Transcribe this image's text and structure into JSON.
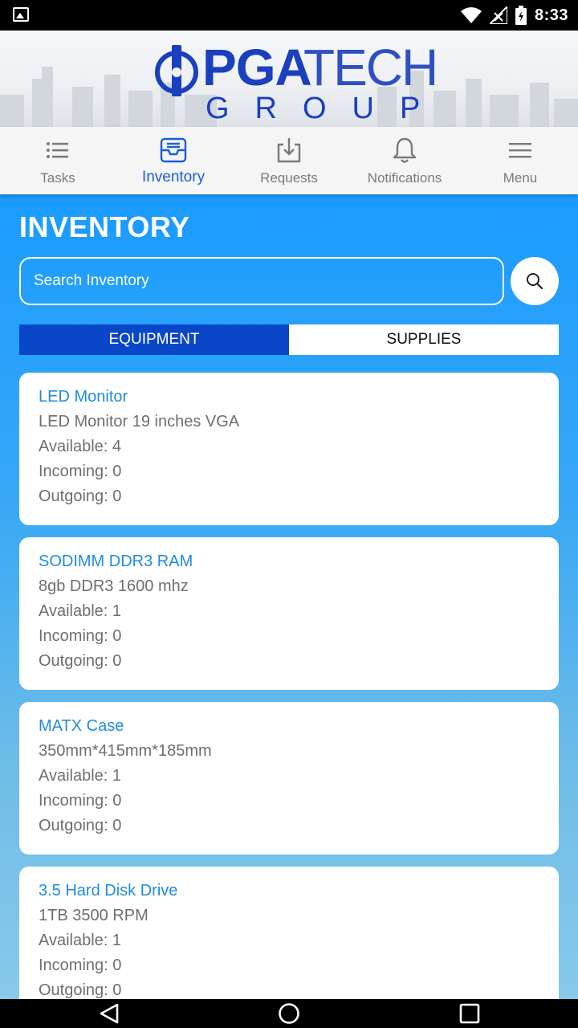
{
  "status_bar": {
    "time": "8:33"
  },
  "header": {
    "logo_main": "PGA",
    "logo_second": "TECH",
    "logo_sub": "GROUP"
  },
  "nav": {
    "items": [
      {
        "label": "Tasks",
        "icon": "list-icon",
        "active": false
      },
      {
        "label": "Inventory",
        "icon": "inbox-tray-icon",
        "active": true
      },
      {
        "label": "Requests",
        "icon": "download-icon",
        "active": false
      },
      {
        "label": "Notifications",
        "icon": "bell-icon",
        "active": false
      },
      {
        "label": "Menu",
        "icon": "hamburger-icon",
        "active": false
      }
    ]
  },
  "main": {
    "title": "INVENTORY",
    "search": {
      "placeholder": "Search Inventory"
    },
    "segments": {
      "equipment": "EQUIPMENT",
      "supplies": "SUPPLIES",
      "selected": "EQUIPMENT"
    },
    "items": [
      {
        "name": "LED Monitor",
        "description": "LED Monitor 19 inches VGA",
        "available": "Available: 4",
        "incoming": "Incoming: 0",
        "outgoing": "Outgoing: 0"
      },
      {
        "name": "SODIMM DDR3 RAM",
        "description": "8gb DDR3 1600 mhz",
        "available": "Available: 1",
        "incoming": "Incoming: 0",
        "outgoing": "Outgoing: 0"
      },
      {
        "name": "MATX Case",
        "description": "350mm*415mm*185mm",
        "available": "Available: 1",
        "incoming": "Incoming: 0",
        "outgoing": "Outgoing: 0"
      },
      {
        "name": "3.5 Hard Disk Drive",
        "description": "1TB 3500 RPM",
        "available": "Available: 1",
        "incoming": "Incoming: 0",
        "outgoing": "Outgoing: 0"
      }
    ]
  },
  "colors": {
    "accent": "#1a5fd6",
    "brand": "#1a3fbf",
    "segment_active": "#0a46c8",
    "item_title": "#1e8ce0"
  }
}
